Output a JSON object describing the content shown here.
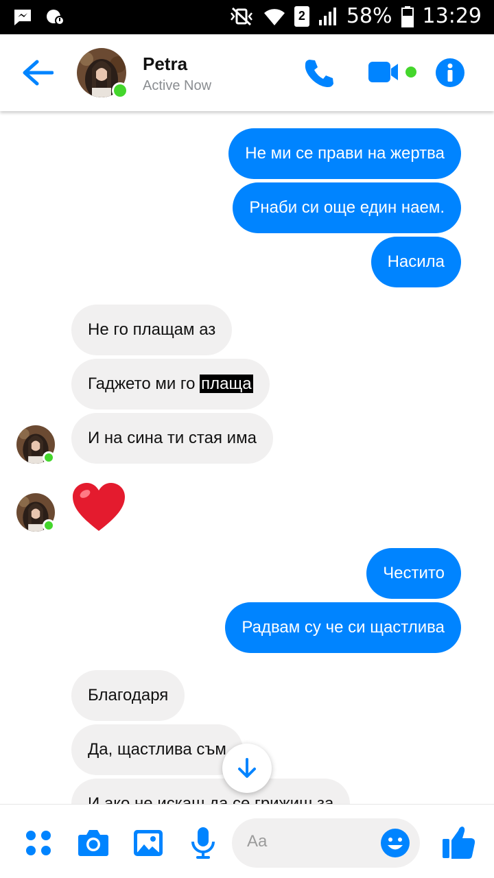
{
  "status_bar": {
    "battery_percent": "58%",
    "time": "13:29",
    "sim": "2"
  },
  "header": {
    "contact_name": "Petra",
    "contact_status": "Active Now"
  },
  "messages": [
    {
      "dir": "out",
      "text": "Не ми се прави на жертва"
    },
    {
      "dir": "out",
      "text": "Рнаби си още един наем."
    },
    {
      "dir": "out",
      "text": "Насила"
    },
    {
      "dir": "in",
      "text": "Не го плащам аз"
    },
    {
      "dir": "in",
      "text_before": "Гаджето ми го ",
      "text_highlight": "плаща"
    },
    {
      "dir": "in",
      "text": "И на сина ти стая има"
    },
    {
      "dir": "in",
      "emoji": "❤"
    },
    {
      "dir": "out",
      "text": "Честито"
    },
    {
      "dir": "out",
      "text": "Радвам су че си щастлива"
    },
    {
      "dir": "in",
      "text": "Благодаря"
    },
    {
      "dir": "in",
      "text": "Да, щастлива съм"
    },
    {
      "dir": "in",
      "text": "И ако не искаш да се грижиш за"
    }
  ],
  "composer": {
    "placeholder": "Aa"
  },
  "colors": {
    "accent": "#0084ff",
    "incoming_bubble": "#f1f0f0",
    "online": "#44d62c"
  }
}
